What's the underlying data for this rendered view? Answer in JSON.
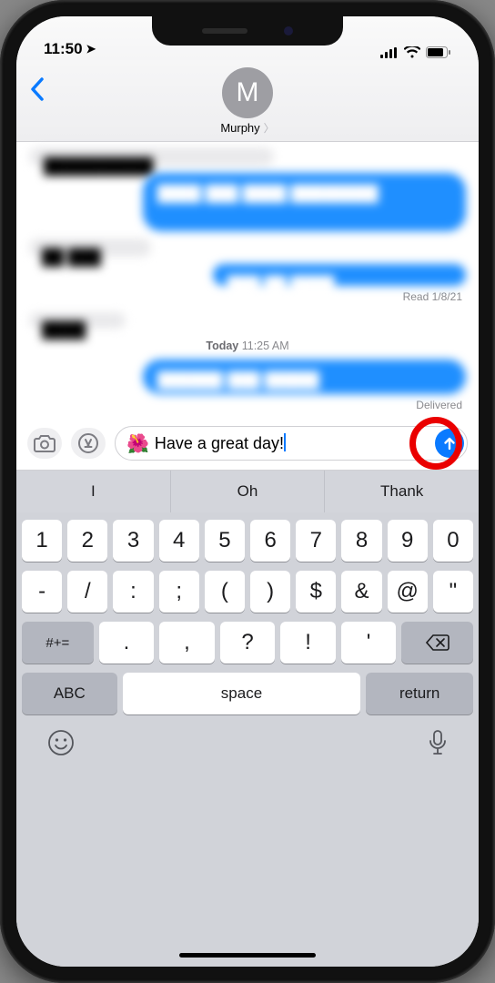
{
  "status": {
    "time": "11:50",
    "location_icon": "➤"
  },
  "header": {
    "back": "‹",
    "avatar_initial": "M",
    "contact_name": "Murphy"
  },
  "thread": {
    "read_label_prefix": "Read",
    "read_date": "1/8/21",
    "today_prefix": "Today",
    "today_time": "11:25 AM",
    "delivered_label": "Delivered"
  },
  "compose": {
    "emoji": "🌺",
    "text": "Have a great day!"
  },
  "suggestions": [
    "I",
    "Oh",
    "Thank"
  ],
  "keyboard": {
    "row1": [
      "1",
      "2",
      "3",
      "4",
      "5",
      "6",
      "7",
      "8",
      "9",
      "0"
    ],
    "row2": [
      "-",
      "/",
      ":",
      ";",
      "(",
      ")",
      "$",
      "&",
      "@",
      "\""
    ],
    "row3_shift": "#+=",
    "row3": [
      ".",
      ",",
      "?",
      "!",
      "'"
    ],
    "row3_bksp": "⌫",
    "row4_abc": "ABC",
    "row4_space": "space",
    "row4_return": "return"
  }
}
